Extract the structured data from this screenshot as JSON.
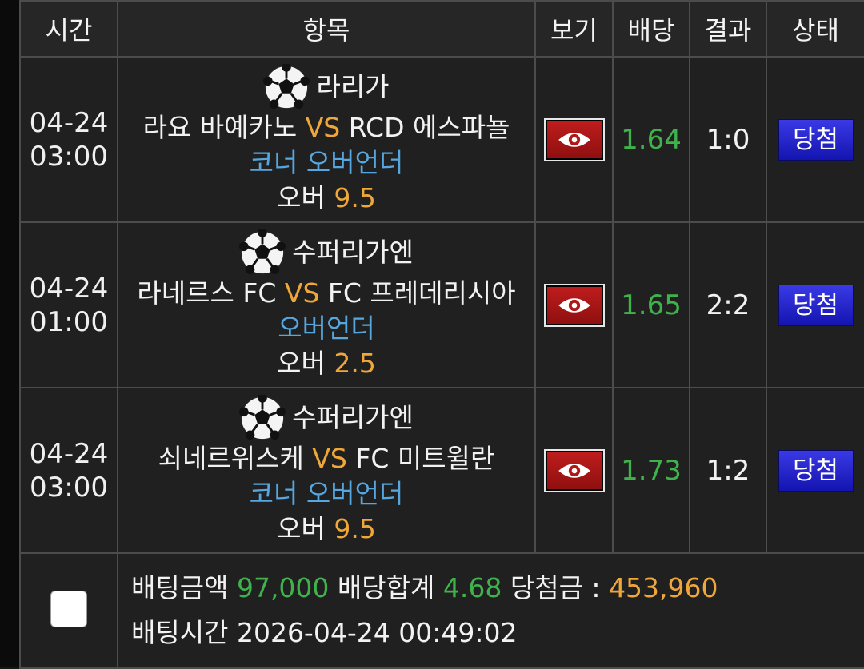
{
  "header": {
    "time": "시간",
    "item": "항목",
    "view": "보기",
    "odds": "배당",
    "result": "결과",
    "status": "상태"
  },
  "rows": [
    {
      "date": "04-24",
      "time": "03:00",
      "league": "라리가",
      "home": "라요 바예카노",
      "vs": "VS",
      "away": "RCD 에스파뇰",
      "market": "코너 오버언더",
      "pick": "오버",
      "line": "9.5",
      "odds": "1.64",
      "result": "1:0",
      "status": "당첨"
    },
    {
      "date": "04-24",
      "time": "01:00",
      "league": "수퍼리가엔",
      "home": "라네르스 FC",
      "vs": "VS",
      "away": "FC 프레데리시아",
      "market": "오버언더",
      "pick": "오버",
      "line": "2.5",
      "odds": "1.65",
      "result": "2:2",
      "status": "당첨"
    },
    {
      "date": "04-24",
      "time": "03:00",
      "league": "수퍼리가엔",
      "home": "쇠네르위스케",
      "vs": "VS",
      "away": "FC 미트윌란",
      "market": "코너 오버언더",
      "pick": "오버",
      "line": "9.5",
      "odds": "1.73",
      "result": "1:2",
      "status": "당첨"
    }
  ],
  "summary": {
    "bet_amount_label": "배팅금액",
    "bet_amount": "97,000",
    "odds_total_label": "배당합계",
    "odds_total": "4.68",
    "payout_label": "당첨금 :",
    "payout": "453,960",
    "bet_time_label": "배팅시간",
    "bet_time": "2026-04-24 00:49:02"
  },
  "icons": {
    "league": "soccer-ball-icon",
    "view": "eye-icon"
  },
  "colors": {
    "odds": "#3fb24c",
    "highlight": "#f0a73a",
    "market": "#56a7e0",
    "view_button": "#b01818",
    "status_badge": "#2a2ad0"
  }
}
